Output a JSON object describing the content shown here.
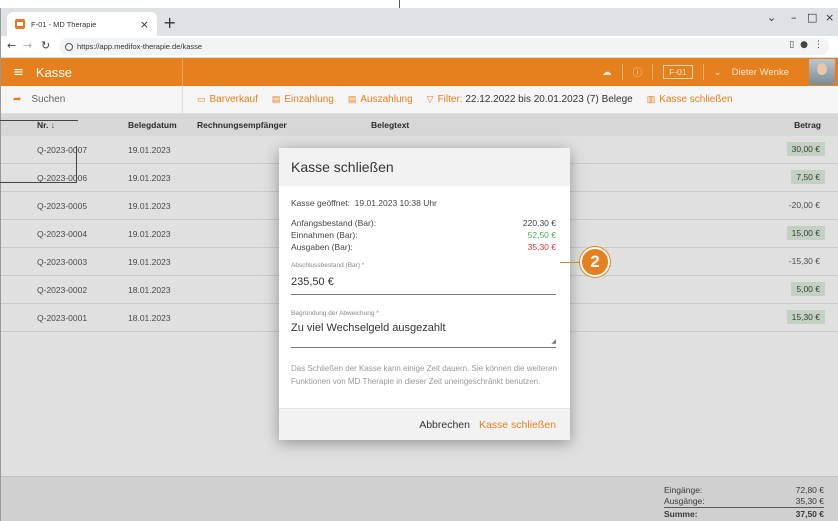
{
  "browser": {
    "tab_title": "F-01 - MD Therapie",
    "url": "https://app.medifox-therapie.de/kasse"
  },
  "app": {
    "title": "Kasse",
    "header_badge": "F-01",
    "user_name": "Dieter Wenke"
  },
  "toolbar": {
    "search_label": "Suchen",
    "barverkauf": "Barverkauf",
    "einzahlung": "Einzahlung",
    "auszahlung": "Auszahlung",
    "filter_label": "Filter:",
    "filter_value": "22.12.2022 bis 20.01.2023 (7) Belege",
    "kasse_schliessen": "Kasse schließen"
  },
  "table": {
    "headers": {
      "nr": "Nr.",
      "belegdatum": "Belegdatum",
      "rechnungsempfaenger": "Rechnungsempfänger",
      "belegtext": "Belegtext",
      "betrag": "Betrag"
    },
    "rows": [
      {
        "nr": "Q-2023-0007",
        "date": "19.01.2023",
        "amount": "30,00 €",
        "positive": true
      },
      {
        "nr": "Q-2023-0006",
        "date": "19.01.2023",
        "amount": "7,50 €",
        "positive": true
      },
      {
        "nr": "Q-2023-0005",
        "date": "19.01.2023",
        "amount": "-20,00 €",
        "positive": false
      },
      {
        "nr": "Q-2023-0004",
        "date": "19.01.2023",
        "amount": "15,00 €",
        "positive": true
      },
      {
        "nr": "Q-2023-0003",
        "date": "19.01.2023",
        "amount": "-15,30 €",
        "positive": false
      },
      {
        "nr": "Q-2023-0002",
        "date": "18.01.2023",
        "amount": "5,00 €",
        "positive": true
      },
      {
        "nr": "Q-2023-0001",
        "date": "18.01.2023",
        "amount": "15,30 €",
        "positive": true
      }
    ]
  },
  "footer": {
    "eingaenge_label": "Eingänge:",
    "eingaenge_value": "72,80 €",
    "ausgaenge_label": "Ausgänge:",
    "ausgaenge_value": "35,30 €",
    "summe_label": "Summe:",
    "summe_value": "37,50 €"
  },
  "dialog": {
    "title": "Kasse schließen",
    "opened_label": "Kasse geöffnet:",
    "opened_value": "19.01.2023 10:38 Uhr",
    "anfangsbestand_label": "Anfangsbestand (Bar):",
    "anfangsbestand_value": "220,30 €",
    "einnahmen_label": "Einnahmen (Bar):",
    "einnahmen_value": "52,50 €",
    "ausgaben_label": "Ausgaben (Bar):",
    "ausgaben_value": "35,30 €",
    "abschluss_label": "Abschlussbestand (Bar) *",
    "abschluss_value": "235,50 €",
    "begruendung_label": "Begründung der Abweichung *",
    "begruendung_value": "Zu viel Wechselgeld ausgezahlt",
    "note": "Das Schließen der Kasse kann einige Zeit dauern. Sie können die weiteren Funktionen von MD Therapie in dieser Zeit uneingeschränkt benutzen.",
    "cancel": "Abbrechen",
    "confirm": "Kasse schließen"
  },
  "callout": {
    "number": "2"
  },
  "colors": {
    "accent": "#e6801e",
    "positive_text": "#4caf50",
    "negative_text": "#e53935",
    "positive_badge_bg": "#dfeedd"
  }
}
